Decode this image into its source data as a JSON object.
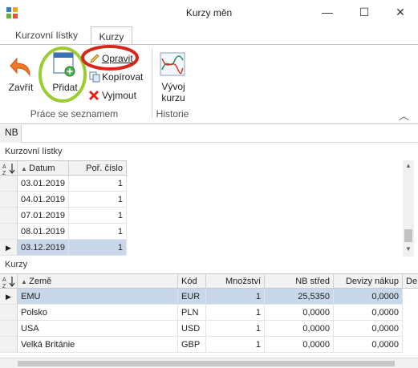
{
  "window": {
    "title": "Kurzy měn",
    "minimize_glyph": "—",
    "maximize_glyph": "☐",
    "close_glyph": "✕"
  },
  "ribbon": {
    "tabs": [
      {
        "label": "Kurzovní lístky",
        "active": false
      },
      {
        "label": "Kurzy",
        "active": true
      }
    ],
    "buttons": {
      "back": "Zavřít",
      "add": "Přidat",
      "edit": "Opravit",
      "copy": "Kopírovat",
      "cut": "Vyjmout",
      "history": "Vývoj kurzu"
    },
    "groups": {
      "list": "Práce se seznamem",
      "history": "Historie"
    },
    "collapse_glyph": "︿"
  },
  "source_tab": "NB",
  "sheets": {
    "title": "Kurzovní lístky",
    "columns": {
      "date": "Datum",
      "order": "Poř. číslo"
    },
    "rows": [
      {
        "date": "03.01.2019",
        "order": "1",
        "selected": false
      },
      {
        "date": "04.01.2019",
        "order": "1",
        "selected": false
      },
      {
        "date": "07.01.2019",
        "order": "1",
        "selected": false
      },
      {
        "date": "08.01.2019",
        "order": "1",
        "selected": false
      },
      {
        "date": "03.12.2019",
        "order": "1",
        "selected": true
      }
    ]
  },
  "rates": {
    "title": "Kurzy",
    "columns": {
      "country": "Země",
      "code": "Kód",
      "amount": "Množství",
      "mid": "NB střed",
      "buy": "Devizy nákup",
      "more": "De"
    },
    "rows": [
      {
        "country": "EMU",
        "code": "EUR",
        "amount": "1",
        "mid": "25,5350",
        "buy": "0,0000",
        "selected": true
      },
      {
        "country": "Polsko",
        "code": "PLN",
        "amount": "1",
        "mid": "0,0000",
        "buy": "0,0000",
        "selected": false
      },
      {
        "country": "USA",
        "code": "USD",
        "amount": "1",
        "mid": "0,0000",
        "buy": "0,0000",
        "selected": false
      },
      {
        "country": "Velká Británie",
        "code": "GBP",
        "amount": "1",
        "mid": "0,0000",
        "buy": "0,0000",
        "selected": false
      }
    ]
  },
  "colors": {
    "selection": "#c9d7ea",
    "add_highlight": "#9acd32",
    "edit_highlight": "#d9261c"
  }
}
